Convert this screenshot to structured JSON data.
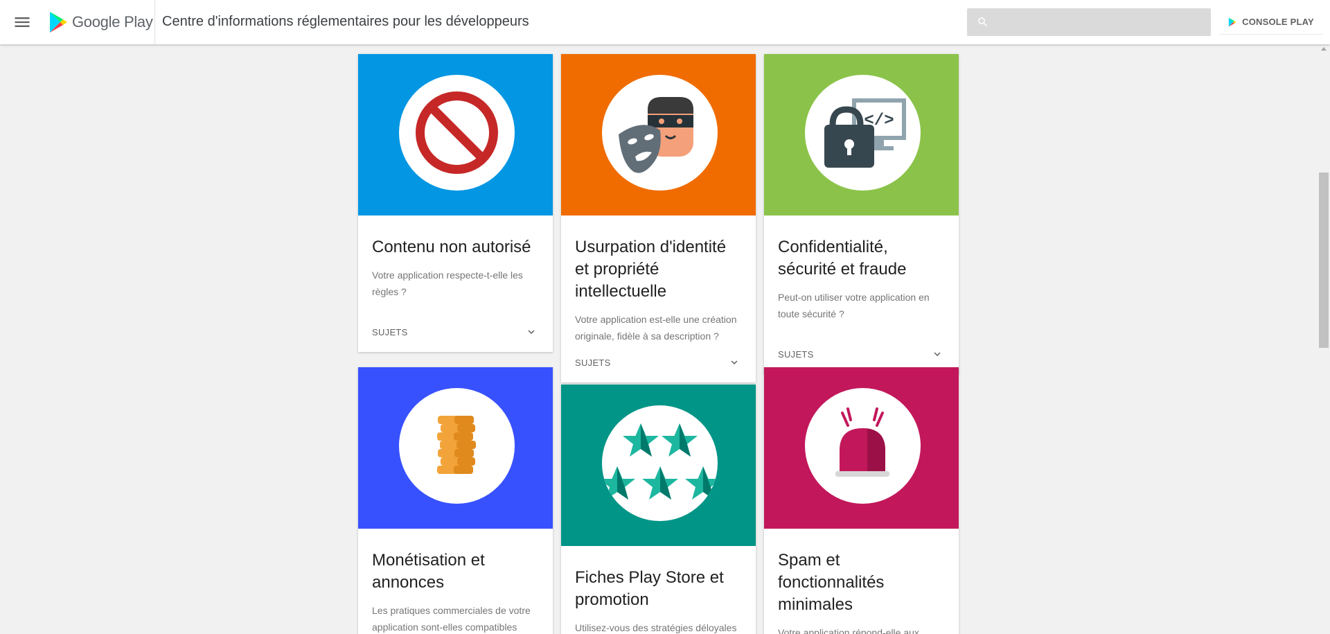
{
  "header": {
    "logo_text": "Google Play",
    "page_title": "Centre d'informations réglementaires pour les développeurs",
    "search_placeholder": "",
    "console_button_label": "CONSOLE PLAY"
  },
  "colors": {
    "blue": "#0396e3",
    "orange": "#f06c00",
    "green": "#8bc34a",
    "indigo": "#3851ff",
    "teal": "#009587",
    "magenta": "#c2185b"
  },
  "cards": [
    {
      "title": "Contenu non autorisé",
      "description": "Votre application respecte-t-elle les règles ?",
      "topics_label": "SUJETS",
      "icon": "prohibited-icon"
    },
    {
      "title": "Usurpation d'identité et propriété intellectuelle",
      "description": "Votre application est-elle une création originale, fidèle à sa description ?",
      "topics_label": "SUJETS",
      "icon": "impersonation-icon"
    },
    {
      "title": "Confidentialité, sécurité et fraude",
      "description": "Peut-on utiliser votre application en toute sécurité ?",
      "topics_label": "SUJETS",
      "icon": "lock-computer-icon"
    },
    {
      "title": "Monétisation et annonces",
      "description": "Les pratiques commerciales de votre application sont-elles compatibles",
      "icon": "coins-icon"
    },
    {
      "title": "Fiches Play Store et promotion",
      "description": "Utilisez-vous des stratégies déloyales",
      "icon": "stars-icon"
    },
    {
      "title": "Spam et fonctionnalités minimales",
      "description": "Votre application répond-elle aux",
      "icon": "siren-icon"
    }
  ]
}
